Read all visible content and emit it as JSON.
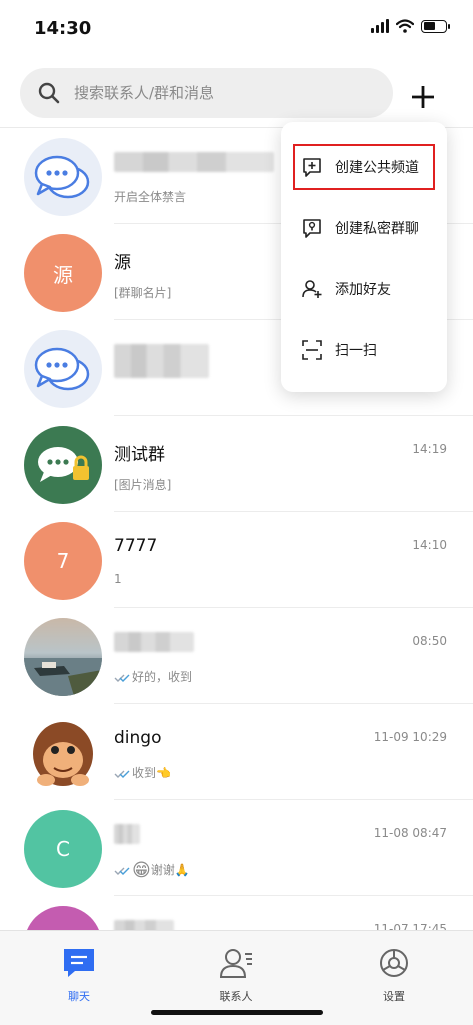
{
  "status": {
    "time": "14:30"
  },
  "search": {
    "placeholder": "搜索联系人/群和消息"
  },
  "menu": {
    "items": [
      {
        "label": "创建公共频道",
        "icon": "add-channel-icon",
        "highlighted": true
      },
      {
        "label": "创建私密群聊",
        "icon": "private-group-icon"
      },
      {
        "label": "添加好友",
        "icon": "add-friend-icon"
      },
      {
        "label": "扫一扫",
        "icon": "scan-icon"
      }
    ]
  },
  "chats": [
    {
      "title": "",
      "sub": "开启全体禁言",
      "time": "",
      "avatar_text": "",
      "avatar_type": "chat-bubbles"
    },
    {
      "title": "源",
      "sub": "[群聊名片]",
      "time": "",
      "avatar_text": "源",
      "avatar_type": "text",
      "avatar_color": "#f0906c"
    },
    {
      "title": "",
      "sub": "",
      "time": "",
      "avatar_text": "",
      "avatar_type": "chat-bubbles"
    },
    {
      "title": "测试群",
      "sub": "[图片消息]",
      "time": "14:19",
      "avatar_text": "",
      "avatar_type": "locked-group",
      "avatar_color": "#3c7a52"
    },
    {
      "title": "7777",
      "sub": "1",
      "time": "14:10",
      "avatar_text": "7",
      "avatar_type": "text",
      "avatar_color": "#f0906c"
    },
    {
      "title": "",
      "sub": "好的，收到",
      "time": "08:50",
      "avatar_text": "",
      "avatar_type": "photo-boat"
    },
    {
      "title": "dingo",
      "sub": "收到",
      "time": "11-09 10:29",
      "avatar_text": "",
      "avatar_type": "photo-monkey"
    },
    {
      "title": "",
      "sub": "谢谢",
      "time": "11-08 08:47",
      "avatar_text": "C",
      "avatar_type": "text",
      "avatar_color": "#52c4a2"
    },
    {
      "title": "",
      "sub": "",
      "time": "11-07 17:45",
      "avatar_text": "",
      "avatar_type": "text",
      "avatar_color": "#c45cb0"
    }
  ],
  "tabs": [
    {
      "label": "聊天",
      "icon": "chat-icon",
      "active": true
    },
    {
      "label": "联系人",
      "icon": "contacts-icon",
      "active": false
    },
    {
      "label": "设置",
      "icon": "settings-icon",
      "active": false
    }
  ]
}
